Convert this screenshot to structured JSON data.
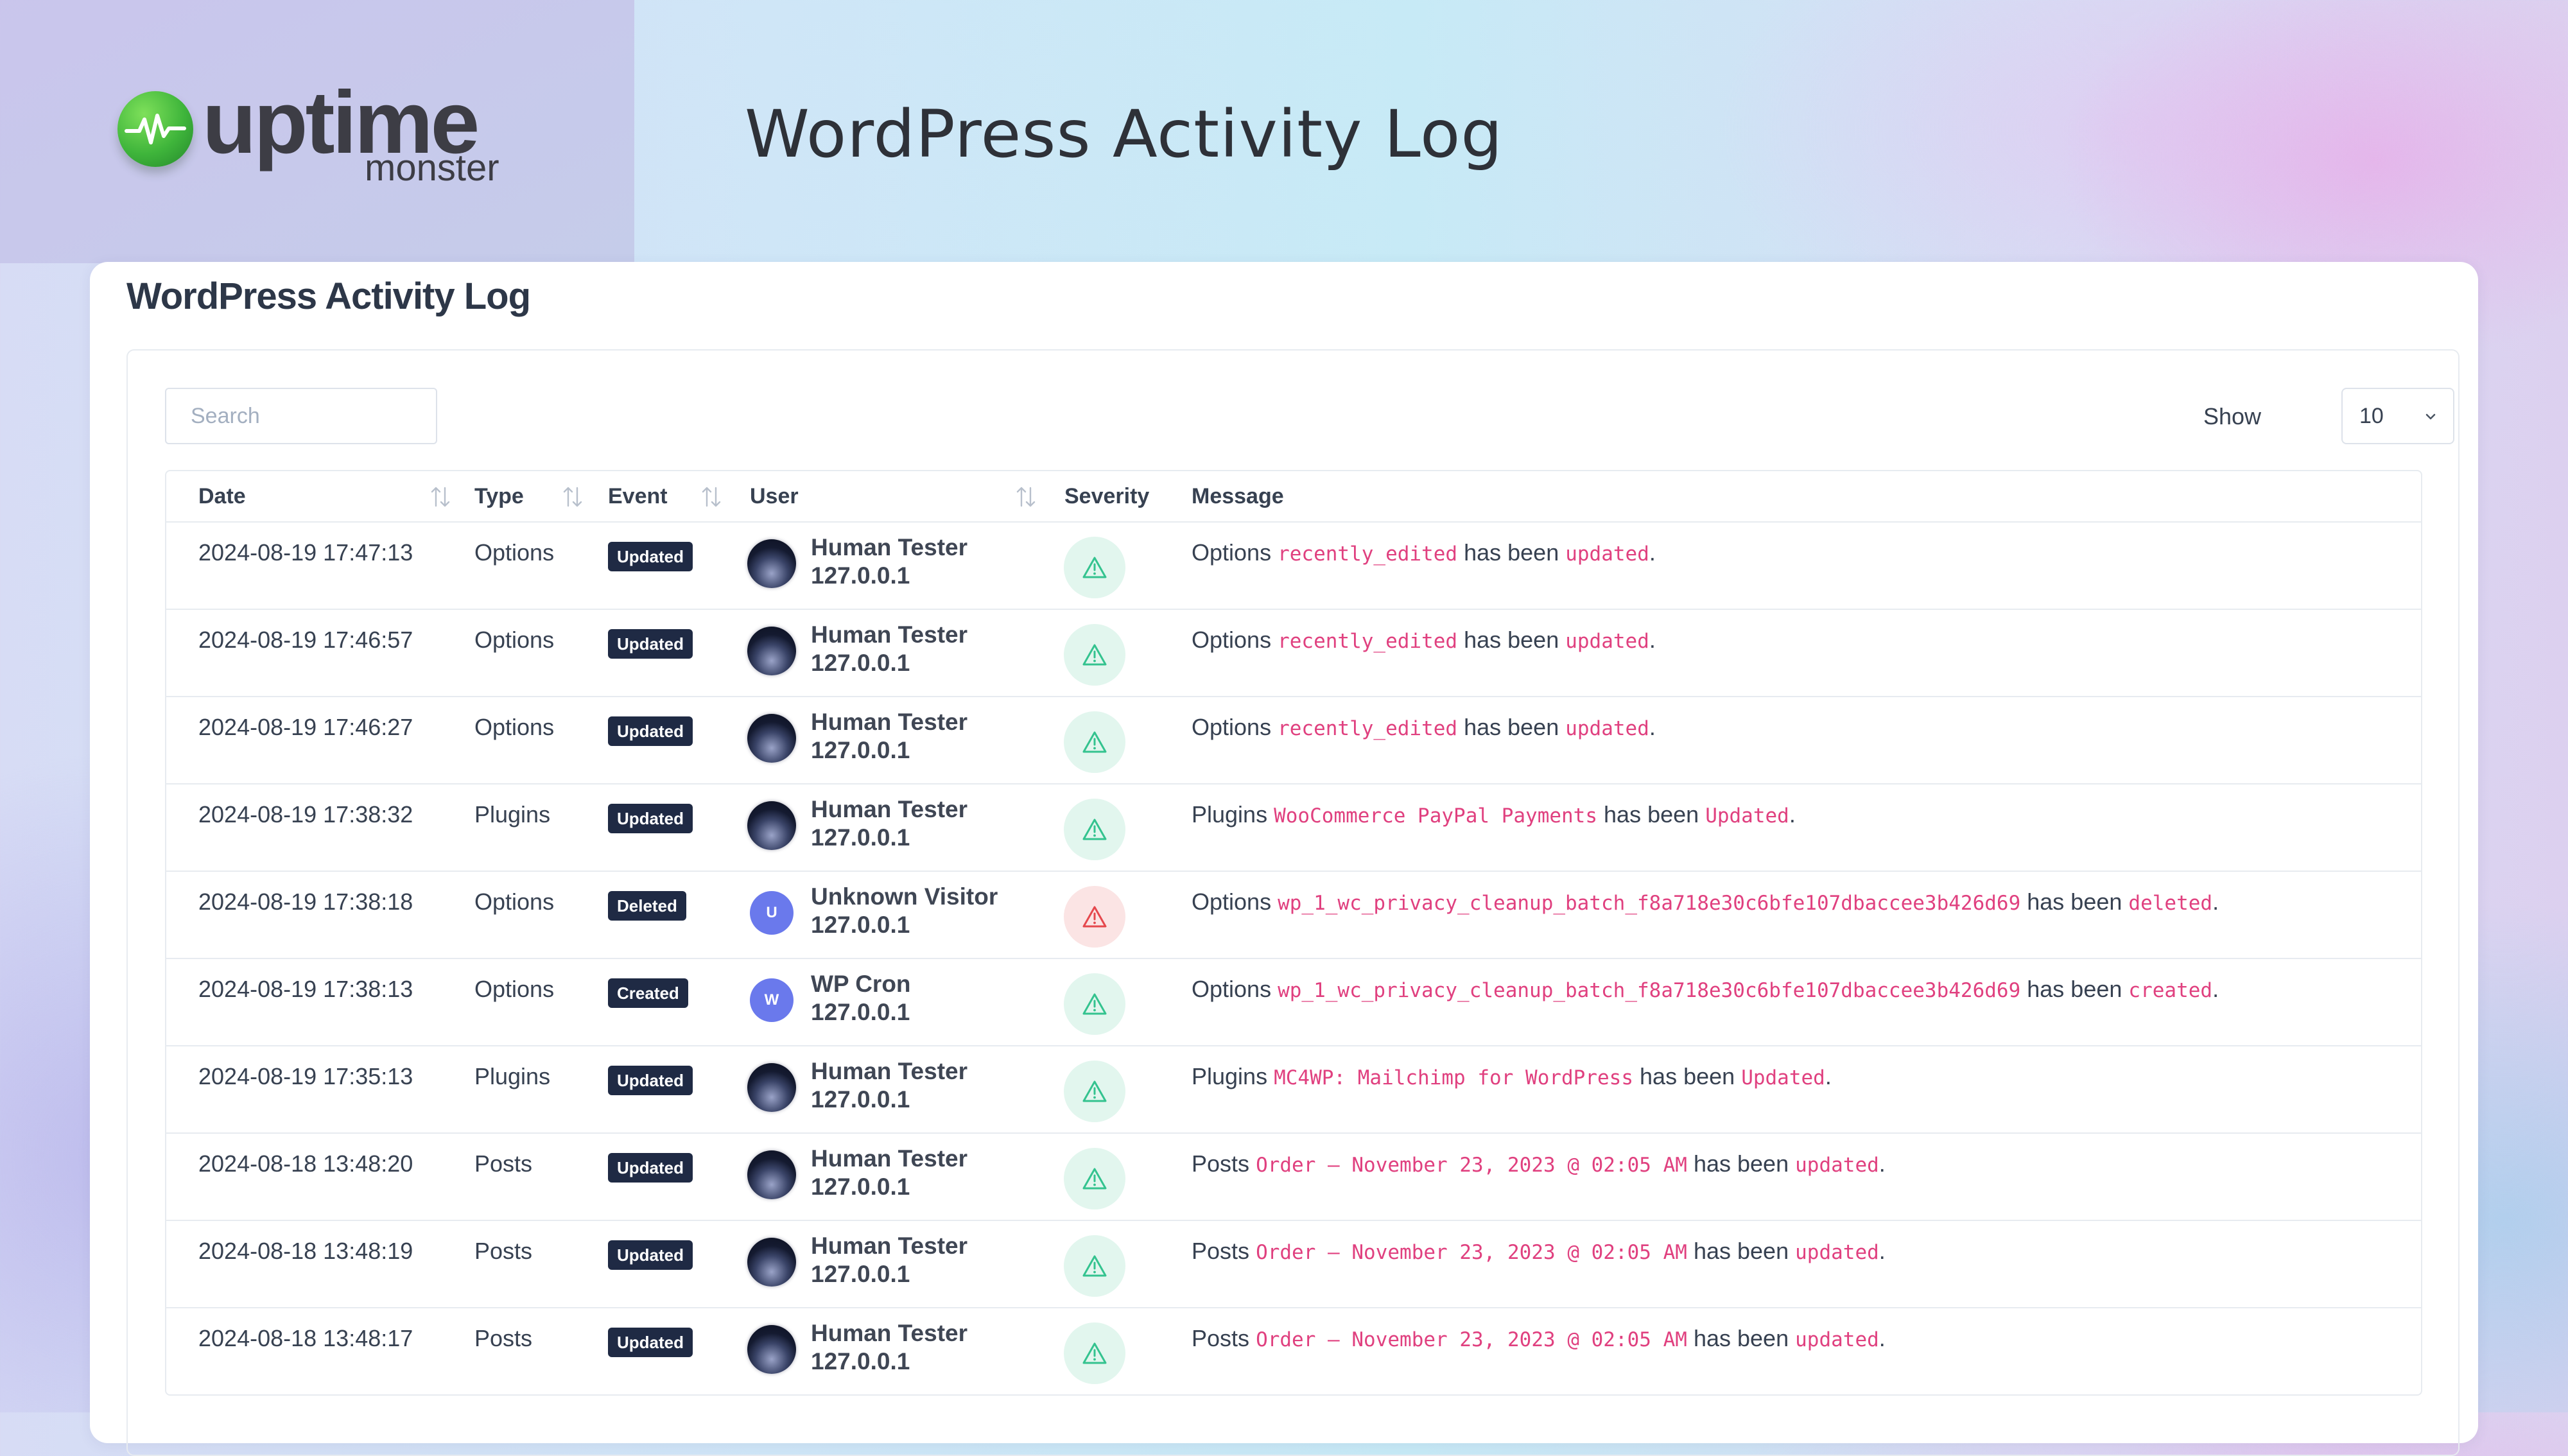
{
  "brand": {
    "name": "uptime",
    "sub": "monster"
  },
  "header": {
    "title": "WordPress Activity Log"
  },
  "card": {
    "title": "WordPress Activity Log"
  },
  "search": {
    "placeholder": "Search"
  },
  "page_size": {
    "label": "Show",
    "value": "10"
  },
  "columns": {
    "date": "Date",
    "type": "Type",
    "event": "Event",
    "user": "User",
    "severity": "Severity",
    "message": "Message"
  },
  "colors": {
    "badge": "#1f2a44",
    "code": "#e0407f",
    "severity_low": "#34c38f",
    "severity_high": "#e5484d",
    "avatar_letter": "#6a79ec"
  },
  "rows": [
    {
      "date": "2024-08-19 17:47:13",
      "type": "Options",
      "event": "Updated",
      "user": "Human Tester",
      "ip": "127.0.0.1",
      "initial": "",
      "severity": "low",
      "msg_pre": "Options",
      "msg_code": "recently_edited",
      "msg_mid": "has been",
      "msg_action": "updated",
      "msg_end": "."
    },
    {
      "date": "2024-08-19 17:46:57",
      "type": "Options",
      "event": "Updated",
      "user": "Human Tester",
      "ip": "127.0.0.1",
      "initial": "",
      "severity": "low",
      "msg_pre": "Options",
      "msg_code": "recently_edited",
      "msg_mid": "has been",
      "msg_action": "updated",
      "msg_end": "."
    },
    {
      "date": "2024-08-19 17:46:27",
      "type": "Options",
      "event": "Updated",
      "user": "Human Tester",
      "ip": "127.0.0.1",
      "initial": "",
      "severity": "low",
      "msg_pre": "Options",
      "msg_code": "recently_edited",
      "msg_mid": "has been",
      "msg_action": "updated",
      "msg_end": "."
    },
    {
      "date": "2024-08-19 17:38:32",
      "type": "Plugins",
      "event": "Updated",
      "user": "Human Tester",
      "ip": "127.0.0.1",
      "initial": "",
      "severity": "low",
      "msg_pre": "Plugins",
      "msg_code": "WooCommerce PayPal Payments",
      "msg_mid": "has been",
      "msg_action": "Updated",
      "msg_end": "."
    },
    {
      "date": "2024-08-19 17:38:18",
      "type": "Options",
      "event": "Deleted",
      "user": "Unknown Visitor",
      "ip": "127.0.0.1",
      "initial": "U",
      "severity": "high",
      "msg_pre": "Options",
      "msg_code": "wp_1_wc_privacy_cleanup_batch_f8a718e30c6bfe107dbaccee3b426d69",
      "msg_mid": "has been",
      "msg_action": "deleted",
      "msg_end": "."
    },
    {
      "date": "2024-08-19 17:38:13",
      "type": "Options",
      "event": "Created",
      "user": "WP Cron",
      "ip": "127.0.0.1",
      "initial": "W",
      "severity": "low",
      "msg_pre": "Options",
      "msg_code": "wp_1_wc_privacy_cleanup_batch_f8a718e30c6bfe107dbaccee3b426d69",
      "msg_mid": "has been",
      "msg_action": "created",
      "msg_end": "."
    },
    {
      "date": "2024-08-19 17:35:13",
      "type": "Plugins",
      "event": "Updated",
      "user": "Human Tester",
      "ip": "127.0.0.1",
      "initial": "",
      "severity": "low",
      "msg_pre": "Plugins",
      "msg_code": "MC4WP: Mailchimp for WordPress",
      "msg_mid": "has been",
      "msg_action": "Updated",
      "msg_end": "."
    },
    {
      "date": "2024-08-18 13:48:20",
      "type": "Posts",
      "event": "Updated",
      "user": "Human Tester",
      "ip": "127.0.0.1",
      "initial": "",
      "severity": "low",
      "msg_pre": "Posts",
      "msg_code": "Order – November 23, 2023 @ 02:05 AM",
      "msg_mid": "has been",
      "msg_action": "updated",
      "msg_end": "."
    },
    {
      "date": "2024-08-18 13:48:19",
      "type": "Posts",
      "event": "Updated",
      "user": "Human Tester",
      "ip": "127.0.0.1",
      "initial": "",
      "severity": "low",
      "msg_pre": "Posts",
      "msg_code": "Order – November 23, 2023 @ 02:05 AM",
      "msg_mid": "has been",
      "msg_action": "updated",
      "msg_end": "."
    },
    {
      "date": "2024-08-18 13:48:17",
      "type": "Posts",
      "event": "Updated",
      "user": "Human Tester",
      "ip": "127.0.0.1",
      "initial": "",
      "severity": "low",
      "msg_pre": "Posts",
      "msg_code": "Order – November 23, 2023 @ 02:05 AM",
      "msg_mid": "has been",
      "msg_action": "updated",
      "msg_end": "."
    }
  ]
}
